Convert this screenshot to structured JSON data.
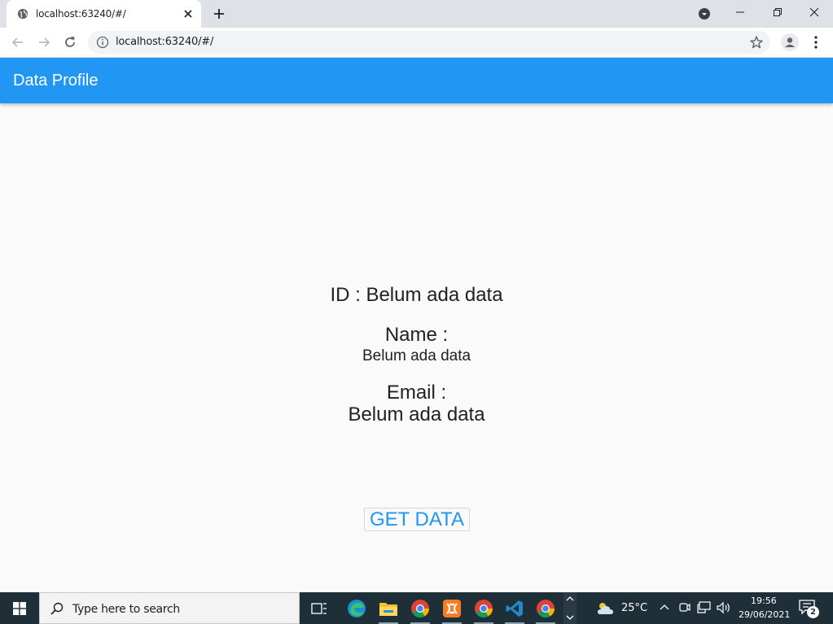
{
  "browser": {
    "tab_title": "localhost:63240/#/",
    "url": "localhost:63240/#/"
  },
  "app": {
    "title": "Data Profile",
    "id_line": "ID : Belum ada data",
    "name_label": "Name :",
    "name_value": "Belum ada data",
    "email_label": "Email :",
    "email_value": "Belum ada data",
    "get_data_label": "GET DATA",
    "accent_color": "#2196f3"
  },
  "taskbar": {
    "search_placeholder": "Type here to search",
    "weather_temp": "25°C",
    "time": "19:56",
    "date": "29/06/2021",
    "notification_count": "2",
    "apps": [
      "task-view",
      "edge",
      "file-explorer",
      "chrome",
      "xampp",
      "chrome",
      "vscode",
      "chrome"
    ]
  }
}
